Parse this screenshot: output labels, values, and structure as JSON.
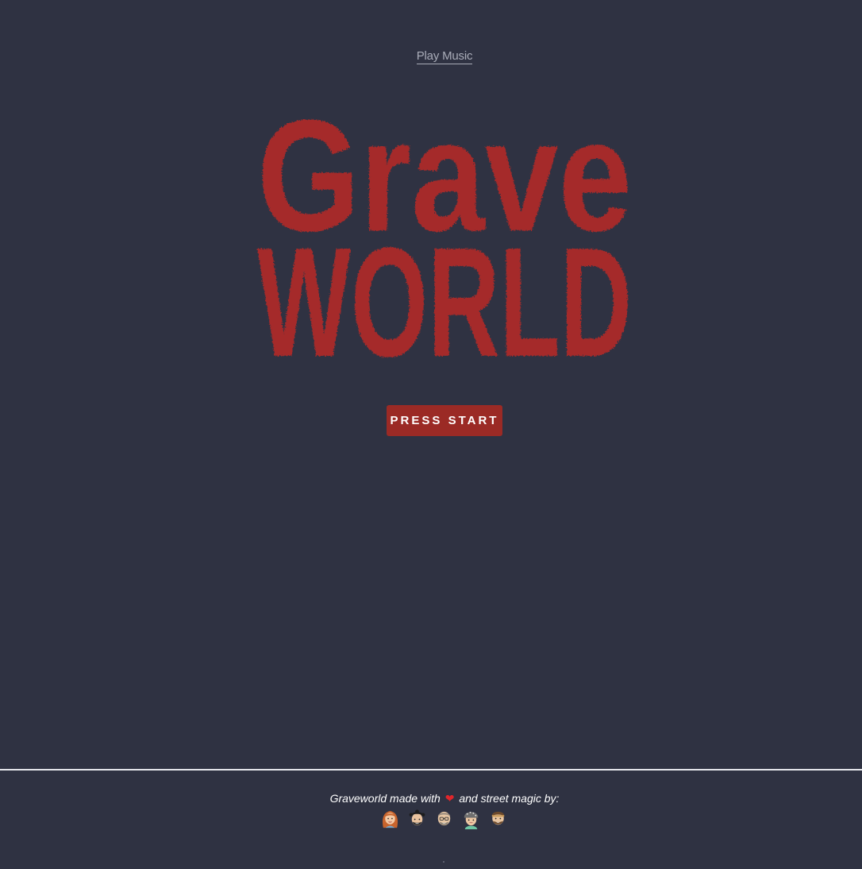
{
  "header": {
    "music_link": "Play Music"
  },
  "logo": {
    "line1": "Grave",
    "line2": "WORLD",
    "color": "#a52c2c"
  },
  "main": {
    "start_button": "PRESS START",
    "button_color": "#9b2a25"
  },
  "footer": {
    "credit_before": "Graveworld made with",
    "credit_after": "and street magic by:",
    "heart": "❤",
    "avatars": [
      "woman-avatar",
      "curly-hair-avatar",
      "glasses-avatar",
      "bandana-avatar",
      "bearded-avatar"
    ]
  },
  "colors": {
    "background": "#2f3242",
    "divider": "#e6e7eb"
  }
}
